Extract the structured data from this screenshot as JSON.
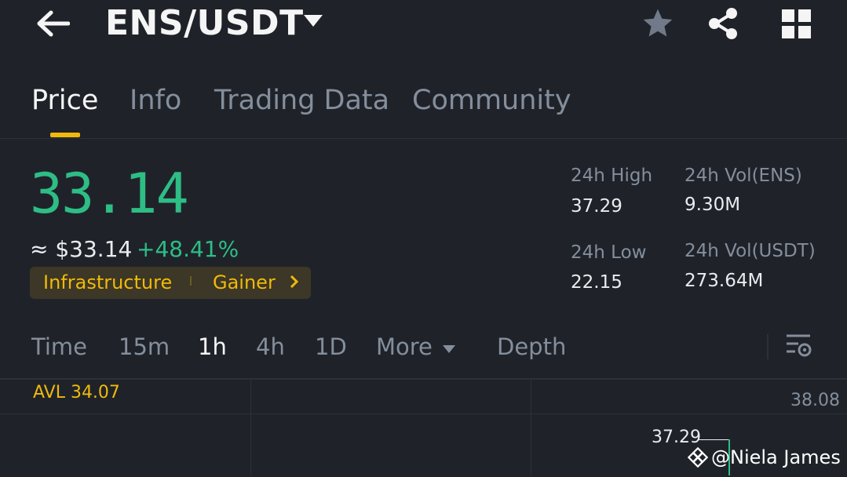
{
  "header": {
    "pair": "ENS/USDT",
    "back_icon": "arrow-left-icon",
    "favorite_icon": "star-icon",
    "share_icon": "share-icon",
    "grid_icon": "grid-icon"
  },
  "tabs": [
    {
      "label": "Price",
      "active": true
    },
    {
      "label": "Info",
      "active": false
    },
    {
      "label": "Trading Data",
      "active": false
    },
    {
      "label": "Community",
      "active": false
    }
  ],
  "price": {
    "last": "33.14",
    "usd": "≈ $33.14",
    "change": "+48.41%",
    "tags": [
      "Infrastructure",
      "Gainer"
    ]
  },
  "stats": {
    "high_label": "24h High",
    "high_value": "37.29",
    "low_label": "24h Low",
    "low_value": "22.15",
    "vol_base_label": "24h Vol(ENS)",
    "vol_base_value": "9.30M",
    "vol_quote_label": "24h Vol(USDT)",
    "vol_quote_value": "273.64M"
  },
  "intervals": {
    "items": [
      "Time",
      "15m",
      "1h",
      "4h",
      "1D",
      "More",
      "Depth"
    ],
    "active": "1h"
  },
  "chart": {
    "avl": "AVL 34.07",
    "axis_top": "38.08",
    "high_marker": "37.29"
  },
  "watermark": "@Niela James",
  "colors": {
    "background": "#1f2329",
    "up": "#2ebd85",
    "accent": "#f0b90b",
    "muted": "#848e9c"
  }
}
